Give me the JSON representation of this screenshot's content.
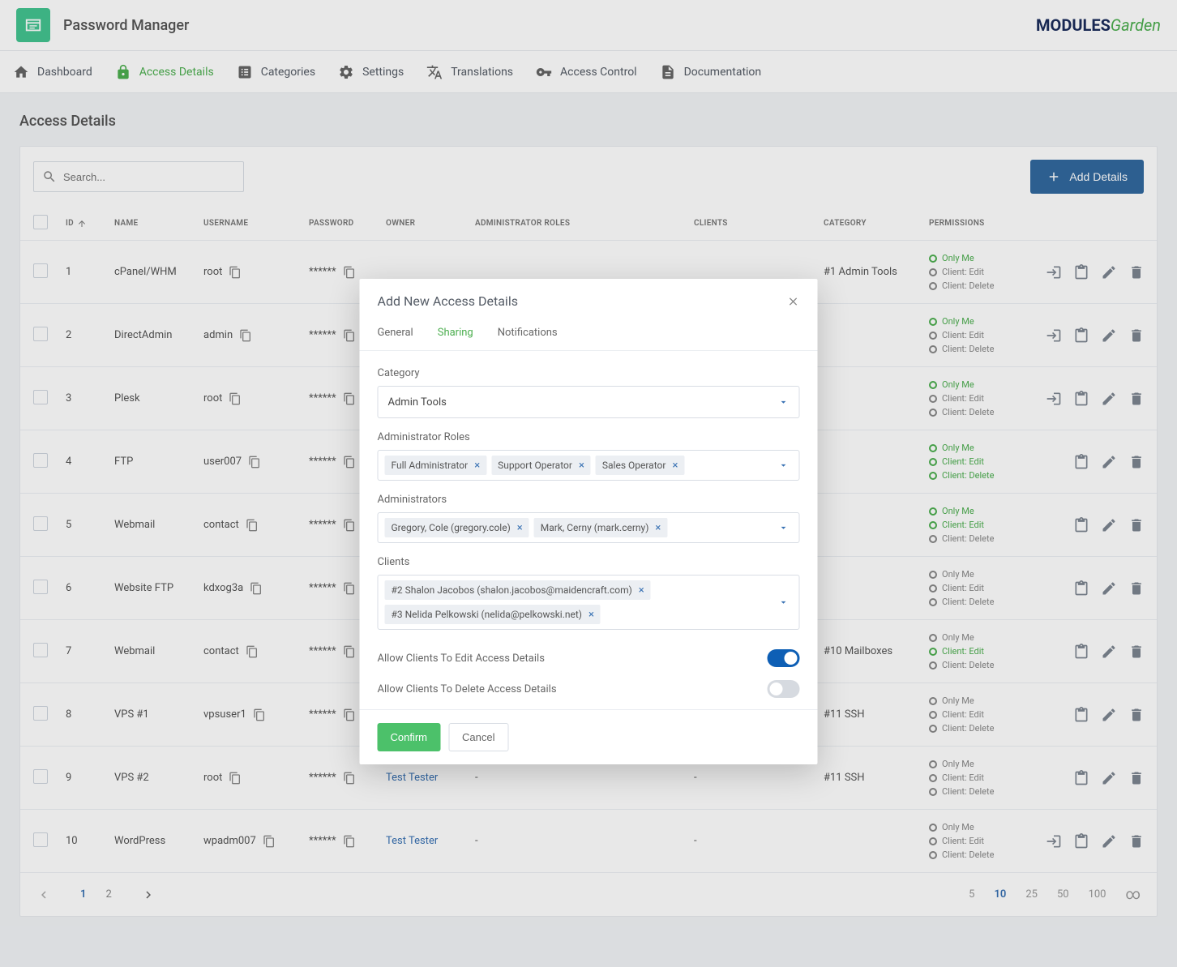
{
  "header": {
    "app_title": "Password Manager",
    "logo_modules": "MODULES",
    "logo_garden": "Garden"
  },
  "nav": {
    "dashboard": "Dashboard",
    "access_details": "Access Details",
    "categories": "Categories",
    "settings": "Settings",
    "translations": "Translations",
    "access_control": "Access Control",
    "documentation": "Documentation"
  },
  "page": {
    "title": "Access Details",
    "search_placeholder": "Search...",
    "add_details": "Add Details"
  },
  "table": {
    "headers": {
      "id": "ID",
      "name": "NAME",
      "username": "USERNAME",
      "password": "PASSWORD",
      "owner": "OWNER",
      "admin_roles": "ADMINISTRATOR ROLES",
      "clients": "CLIENTS",
      "category": "CATEGORY",
      "permissions": "PERMISSIONS"
    },
    "rows": [
      {
        "id": "1",
        "name": "cPanel/WHM",
        "username": "root",
        "password": "******",
        "owner": "",
        "roles": "",
        "clients": "",
        "category": "#1 Admin Tools",
        "perms": [
          {
            "label": "Only Me",
            "green": true
          },
          {
            "label": "Client: Edit",
            "green": false
          },
          {
            "label": "Client: Delete",
            "green": false
          }
        ],
        "login": true
      },
      {
        "id": "2",
        "name": "DirectAdmin",
        "username": "admin",
        "password": "******",
        "owner": "",
        "roles": "",
        "clients": "",
        "category": "",
        "perms": [
          {
            "label": "Only Me",
            "green": true
          },
          {
            "label": "Client: Edit",
            "green": false
          },
          {
            "label": "Client: Delete",
            "green": false
          }
        ],
        "login": true
      },
      {
        "id": "3",
        "name": "Plesk",
        "username": "root",
        "password": "******",
        "owner": "",
        "roles": "",
        "clients": "",
        "category": "",
        "perms": [
          {
            "label": "Only Me",
            "green": true
          },
          {
            "label": "Client: Edit",
            "green": false
          },
          {
            "label": "Client: Delete",
            "green": false
          }
        ],
        "login": true
      },
      {
        "id": "4",
        "name": "FTP",
        "username": "user007",
        "password": "******",
        "owner": "",
        "roles": "",
        "clients": "",
        "category": "",
        "perms": [
          {
            "label": "Only Me",
            "green": true
          },
          {
            "label": "Client: Edit",
            "green": true
          },
          {
            "label": "Client: Delete",
            "green": true
          }
        ],
        "login": false
      },
      {
        "id": "5",
        "name": "Webmail",
        "username": "contact",
        "password": "******",
        "owner": "",
        "roles": "",
        "clients": "",
        "category": "",
        "perms": [
          {
            "label": "Only Me",
            "green": true
          },
          {
            "label": "Client: Edit",
            "green": true
          },
          {
            "label": "Client: Delete",
            "green": false
          }
        ],
        "login": false
      },
      {
        "id": "6",
        "name": "Website FTP",
        "username": "kdxog3a",
        "password": "******",
        "owner": "",
        "roles": "",
        "clients": "",
        "category": "",
        "perms": [
          {
            "label": "Only Me",
            "green": false
          },
          {
            "label": "Client: Edit",
            "green": false
          },
          {
            "label": "Client: Delete",
            "green": false
          }
        ],
        "login": false
      },
      {
        "id": "7",
        "name": "Webmail",
        "username": "contact",
        "password": "******",
        "owner": "",
        "roles": "",
        "clients": "",
        "category": "#10 Mailboxes",
        "perms": [
          {
            "label": "Only Me",
            "green": false
          },
          {
            "label": "Client: Edit",
            "green": true
          },
          {
            "label": "Client: Delete",
            "green": false
          }
        ],
        "login": false
      },
      {
        "id": "8",
        "name": "VPS #1",
        "username": "vpsuser1",
        "password": "******",
        "owner": "",
        "roles": "",
        "clients": "",
        "category": "#11 SSH",
        "perms": [
          {
            "label": "Only Me",
            "green": false
          },
          {
            "label": "Client: Edit",
            "green": false
          },
          {
            "label": "Client: Delete",
            "green": false
          }
        ],
        "login": false
      },
      {
        "id": "9",
        "name": "VPS #2",
        "username": "root",
        "password": "******",
        "owner": "Test Tester",
        "roles": "-",
        "clients": "-",
        "category": "#11 SSH",
        "perms": [
          {
            "label": "Only Me",
            "green": false
          },
          {
            "label": "Client: Edit",
            "green": false
          },
          {
            "label": "Client: Delete",
            "green": false
          }
        ],
        "login": false
      },
      {
        "id": "10",
        "name": "WordPress",
        "username": "wpadm007",
        "password": "******",
        "owner": "Test Tester",
        "roles": "-",
        "clients": "-",
        "category": "",
        "perms": [
          {
            "label": "Only Me",
            "green": false
          },
          {
            "label": "Client: Edit",
            "green": false
          },
          {
            "label": "Client: Delete",
            "green": false
          }
        ],
        "login": true
      }
    ]
  },
  "pagination": {
    "pages": [
      "1",
      "2"
    ],
    "active_page": "1",
    "per_page": [
      "5",
      "10",
      "25",
      "50",
      "100",
      "∞"
    ],
    "active_per_page": "10"
  },
  "modal": {
    "title": "Add New Access Details",
    "tabs": {
      "general": "General",
      "sharing": "Sharing",
      "notifications": "Notifications"
    },
    "labels": {
      "category": "Category",
      "admin_roles": "Administrator Roles",
      "administrators": "Administrators",
      "clients": "Clients",
      "allow_edit": "Allow Clients To Edit Access Details",
      "allow_delete": "Allow Clients To Delete Access Details"
    },
    "values": {
      "category": "Admin Tools",
      "admin_roles": [
        "Full Administrator",
        "Support Operator",
        "Sales Operator"
      ],
      "administrators": [
        "Gregory, Cole (gregory.cole)",
        "Mark, Cerny (mark.cerny)"
      ],
      "clients": [
        "#2 Shalon Jacobos (shalon.jacobos@maidencraft.com)",
        "#3 Nelida Pelkowski (nelida@pelkowski.net)"
      ]
    },
    "buttons": {
      "confirm": "Confirm",
      "cancel": "Cancel"
    }
  }
}
